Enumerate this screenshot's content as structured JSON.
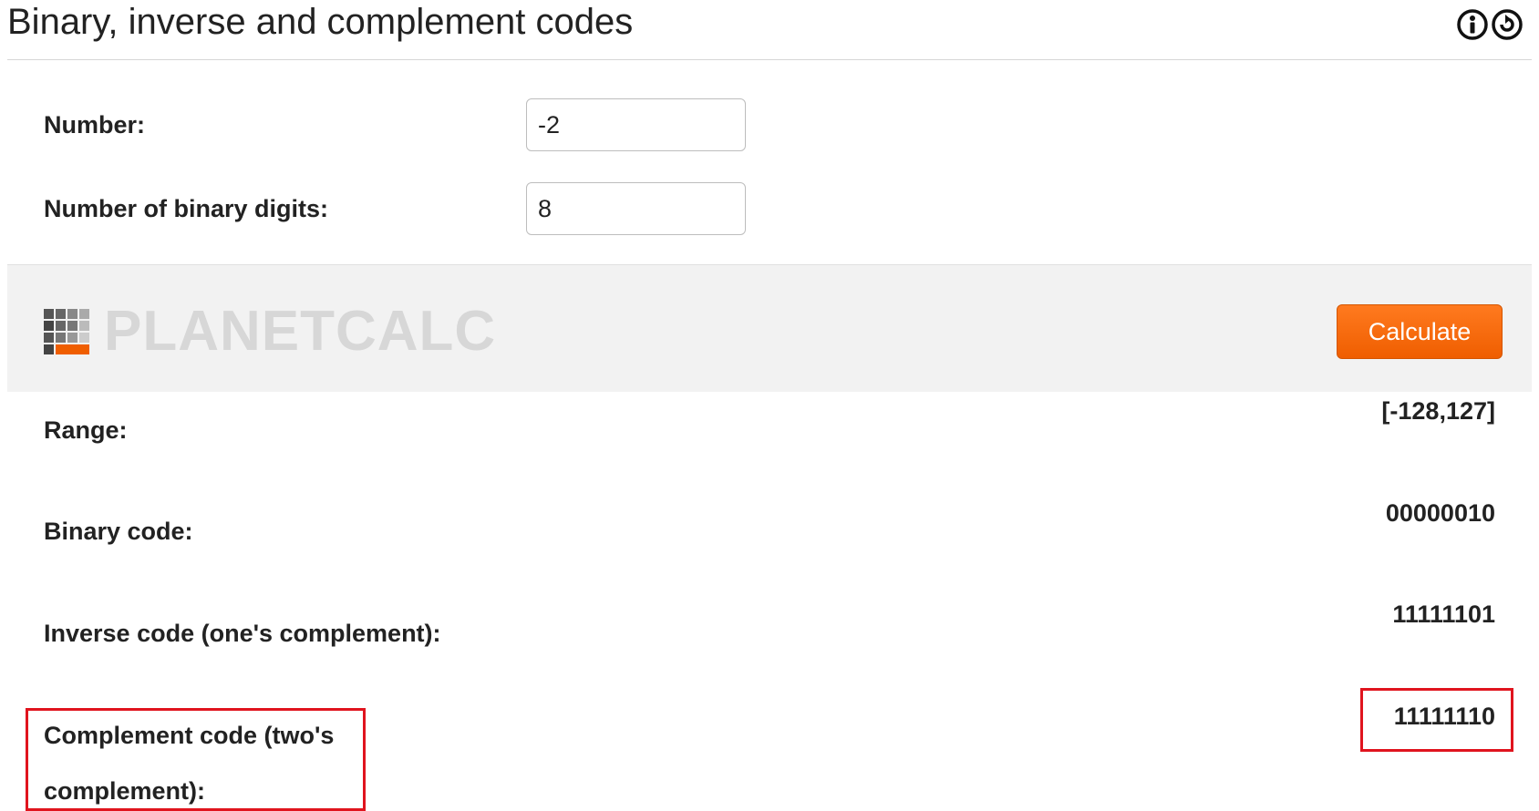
{
  "title": "Binary, inverse and complement codes",
  "header_icons": [
    "info-icon",
    "refresh-icon"
  ],
  "inputs": {
    "number": {
      "label": "Number:",
      "value": "-2"
    },
    "digits": {
      "label": "Number of binary digits:",
      "value": "8"
    }
  },
  "brand": {
    "name": "PLANETCALC"
  },
  "calculate_button": "Calculate",
  "results": {
    "range": {
      "label": "Range:",
      "value": "[-128,127]"
    },
    "binary": {
      "label": "Binary code:",
      "value": "00000010"
    },
    "inverse": {
      "label": "Inverse code (one's complement):",
      "value": "11111101"
    },
    "complement": {
      "label_line1": "Complement code (two's",
      "label_line2": "complement):",
      "value": "11111110"
    }
  },
  "colors": {
    "accent": "#ef5e00",
    "highlight": "#e0141e",
    "bar_background": "#f2f2f2"
  }
}
